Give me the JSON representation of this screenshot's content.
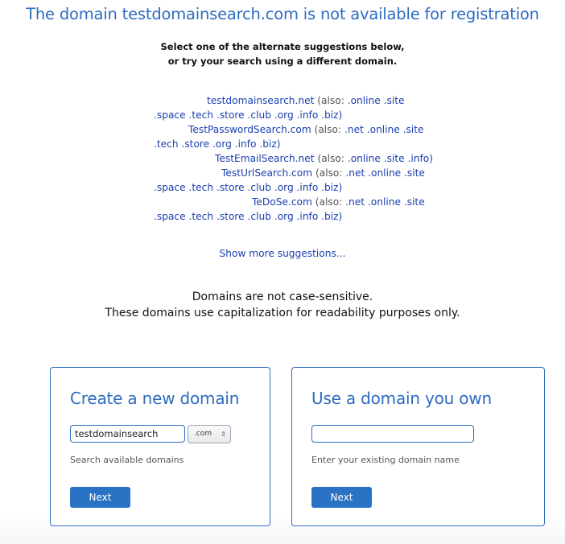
{
  "header": {
    "title": "The domain testdomainsearch.com is not available for registration",
    "subtitle_line1": "Select one of the alternate suggestions below,",
    "subtitle_line2": "or try your search using a different domain."
  },
  "suggestions": [
    {
      "domain": "testdomainsearch.net",
      "also_label": "(also:",
      "line1_ext": ".online .site",
      "line2_ext": ".space .tech .store .club .org .info .biz)"
    },
    {
      "domain": "TestPasswordSearch.com",
      "also_label": "(also:",
      "line1_ext": ".net .online .site",
      "line2_ext": ".tech .store .org .info .biz)"
    },
    {
      "domain": "TestEmailSearch.net",
      "also_label": "(also:",
      "line1_ext": ".online .site .info)",
      "line2_ext": ""
    },
    {
      "domain": "TestUrlSearch.com",
      "also_label": "(also:",
      "line1_ext": ".net .online .site",
      "line2_ext": ".space .tech .store .club .org .info .biz)"
    },
    {
      "domain": "TeDoSe.com",
      "also_label": "(also:",
      "line1_ext": ".net .online .site",
      "line2_ext": ".space .tech .store .club .org .info .biz)"
    }
  ],
  "show_more": "Show more suggestions...",
  "note": {
    "line1": "Domains are not case-sensitive.",
    "line2": "These domains use capitalization for readability purposes only."
  },
  "create_card": {
    "title": "Create a new domain",
    "input_value": "testdomainsearch",
    "tld_selected": ".com",
    "hint": "Search available domains",
    "button": "Next"
  },
  "own_card": {
    "title": "Use a domain you own",
    "input_value": "",
    "hint": "Enter your existing domain name",
    "button": "Next"
  },
  "colors": {
    "accent": "#2d6cc0",
    "link": "#1a3fb0",
    "button": "#2a72c4"
  }
}
